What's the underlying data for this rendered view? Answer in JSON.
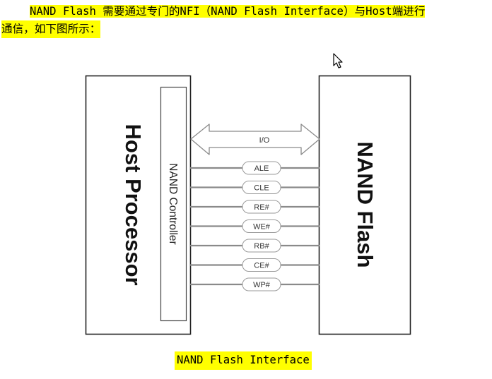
{
  "paragraph": {
    "line1": "NAND Flash 需要通过专门的NFI（NAND Flash Interface）与Host端进行",
    "line2": "通信，如下图所示："
  },
  "diagram": {
    "host_label": "Host Processor",
    "controller_label": "NAND Controller",
    "flash_label": "NAND Flash",
    "io_label": "I/O",
    "signals": [
      "ALE",
      "CLE",
      "RE#",
      "WE#",
      "RB#",
      "CE#",
      "WP#"
    ]
  },
  "caption": "NAND Flash Interface",
  "colors": {
    "highlight": "#ffff00",
    "line": "#8a8a8a",
    "box_border": "#222222"
  }
}
